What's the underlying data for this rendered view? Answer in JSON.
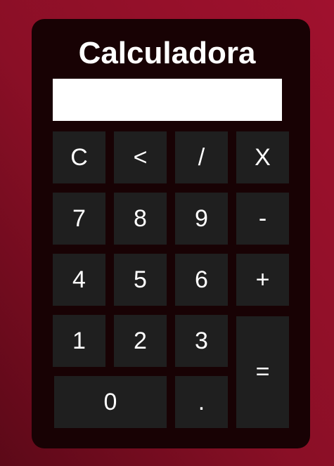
{
  "calculator": {
    "title": "Calculadora",
    "display_value": "",
    "keys": {
      "clear": "C",
      "backspace": "<",
      "divide": "/",
      "multiply": "X",
      "seven": "7",
      "eight": "8",
      "nine": "9",
      "minus": "-",
      "four": "4",
      "five": "5",
      "six": "6",
      "plus": "+",
      "one": "1",
      "two": "2",
      "three": "3",
      "equals": "=",
      "zero": "0",
      "decimal": "."
    }
  },
  "colors": {
    "background_dark": "#5c0918",
    "background_light": "#a0112e",
    "panel": "#180204",
    "key": "#1f1f1f",
    "key_text": "#ffffff",
    "display": "#ffffff"
  }
}
